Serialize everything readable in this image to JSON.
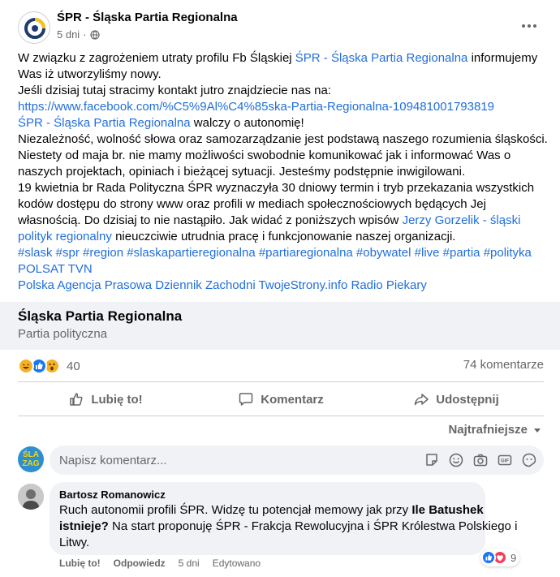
{
  "post": {
    "page_name": "ŚPR - Śląska Partia Regionalna",
    "time": "5 dni",
    "dot": "·",
    "globe_icon": "globe-icon",
    "more_icon": "more-horizontal-icon",
    "body": {
      "l1a": "W związku z zagrożeniem utraty profilu Fb Śląskiej ",
      "l1link": "ŚPR - Śląska Partia Regionalna",
      "l1b": " informujemy",
      "l2": "Was iż utworzyliśmy nowy.",
      "l3": "Jeśli dzisiaj tutaj stracimy kontakt jutro znajdziecie nas na:",
      "url": "https://www.facebook.com/%C5%9Al%C4%85ska-Partia-Regionalna-109481001793819",
      "l5link": " ŚPR - Śląska Partia Regionalna",
      "l5b": " walczy o autonomię!",
      "l6": "Niezależność, wolność słowa oraz samozarządzanie jest podstawą naszego rozumienia śląskości.",
      "l7": "Niestety od maja br. nie mamy możliwości swobodnie komunikować jak i informować Was o",
      "l8": "naszych projektach, opiniach i bieżącej sytuacji. Jesteśmy podstępnie inwigilowani.",
      "l9": "19 kwietnia br Rada Polityczna ŚPR wyznaczyła 30 dniowy termin i tryb przekazania wszystkich",
      "l10": "kodów dostępu do strony www oraz profili w mediach społecznościowych będących Jej",
      "l11a": "własnością. Do dzisiaj to nie nastąpiło. Jak widać z poniższych wpisów ",
      "l11link": "Jerzy Gorzelik - śląski",
      "l12link": "polityk regionalny",
      "l12b": " nieuczciwie utrudnia pracę i funkcjonowanie naszej organizacji.",
      "hashtags": " #slask #spr #region #slaskapartieregionalna #partiaregionalna #obywatel #live #partia #polityka",
      "tags1": "POLSAT TVN",
      "tags2": "Polska Agencja Prasowa Dziennik Zachodni TwojeStrony.info Radio Piekary"
    },
    "link_card": {
      "title": "Śląska Partia Regionalna",
      "subtitle": "Partia polityczna"
    },
    "reaction_count": "40",
    "comments_count": "74 komentarze",
    "actions": {
      "like": "Lubię to!",
      "comment": "Komentarz",
      "share": "Udostępnij"
    },
    "sort_label": "Najtrafniejsze",
    "comment_placeholder": "Napisz komentarz...",
    "my_avatar": {
      "line1": "ŚLA",
      "line2": "ZAG"
    }
  },
  "comment": {
    "author": "Bartosz Romanowicz",
    "l1a": "Ruch autonomii profili ŚPR. Widzę tu potencjał memowy jak przy ",
    "l1b": "Ile Batushek",
    "l2a": "istnieje?",
    "l2b": " Na start proponuję ŚPR - Frakcja Rewolucyjna i ŚPR Królestwa Polskiego i",
    "l3": "Litwy.",
    "like": "Lubię to!",
    "reply": "Odpowiedz",
    "time": "5 dni",
    "edited": "Edytowano",
    "reaction_count": "9"
  },
  "colors": {
    "link": "#216fdb",
    "like_blue": "#1877f2",
    "love_red": "#f33e58",
    "haha_yellow": "#f7b125",
    "secondary_text": "#65676b",
    "card_bg": "#f0f2f5"
  }
}
